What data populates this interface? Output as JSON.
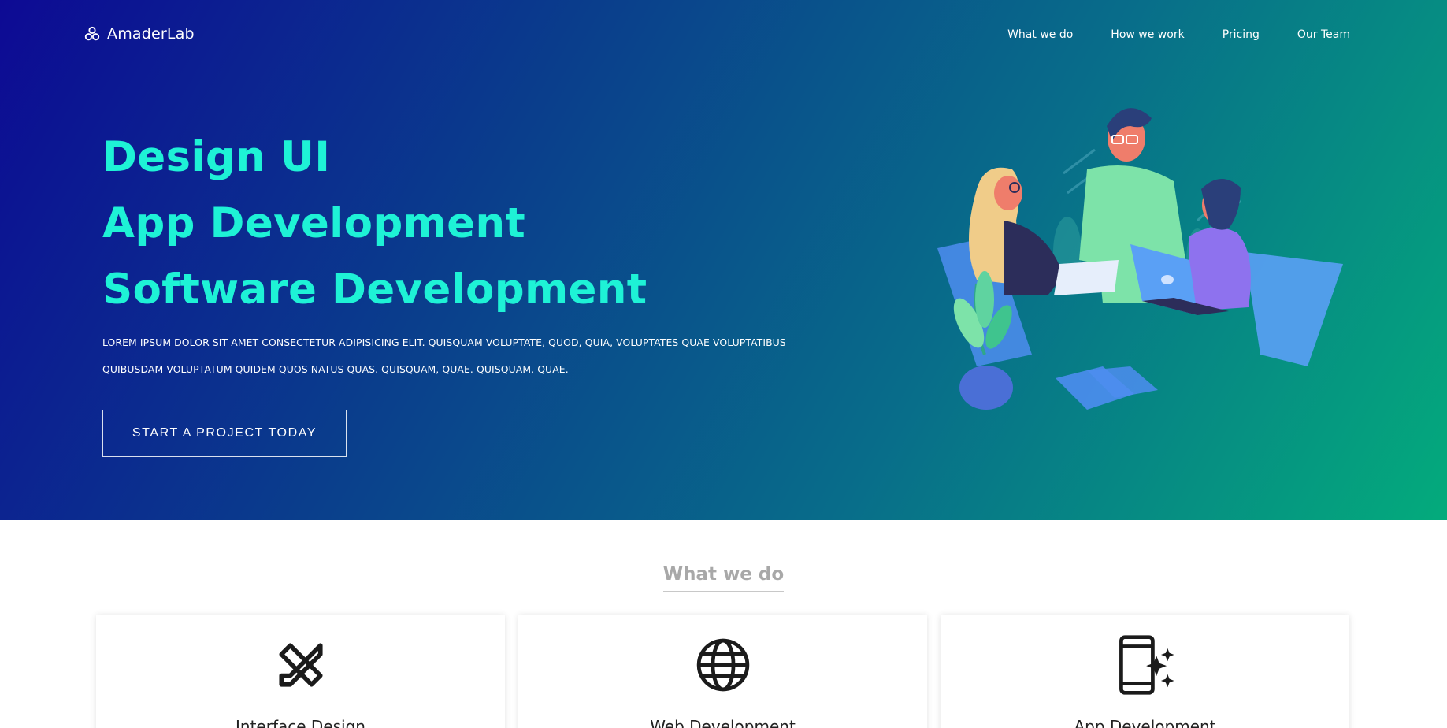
{
  "brand": {
    "name": "AmaderLab",
    "icon": "biohazard-like-logo-icon"
  },
  "nav": {
    "items": [
      "What we do",
      "How we work",
      "Pricing",
      "Our Team"
    ]
  },
  "hero": {
    "lines": [
      "Design UI",
      "App Development",
      "Software Development"
    ],
    "description": "LOREM IPSUM DOLOR SIT AMET CONSECTETUR ADIPISICING ELIT. QUISQUAM VOLUPTATE, QUOD, QUIA, VOLUPTATES QUAE VOLUPTATIBUS QUIBUSDAM VOLUPTATUM QUIDEM QUOS NATUS QUAS. QUISQUAM, QUAE. QUISQUAM, QUAE.",
    "cta_label": "START A PROJECT TODAY",
    "illustration": "team-collaboration-illustration"
  },
  "services": {
    "title": "What we do",
    "cards": [
      {
        "title": "Interface Design",
        "icon": "pencil-ruler-icon"
      },
      {
        "title": "Web Development",
        "icon": "globe-icon"
      },
      {
        "title": "App Development",
        "icon": "mobile-sparkle-icon"
      }
    ]
  },
  "colors": {
    "gradient_start": "#0d0a94",
    "gradient_end": "#04ab7c",
    "headline": "#1ef2d6",
    "section_title": "#a8a8a8"
  }
}
